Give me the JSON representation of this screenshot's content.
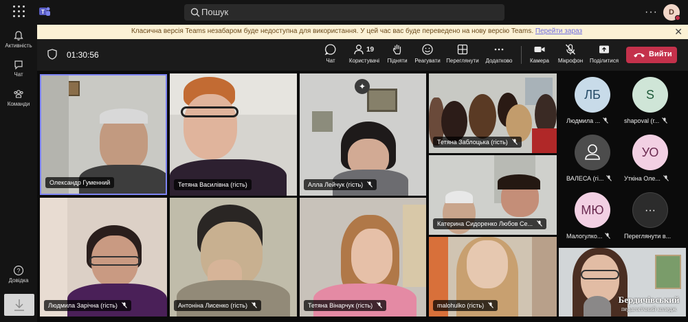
{
  "topbar": {
    "search_placeholder": "Пошук",
    "more_label": "···",
    "user_initial": "D"
  },
  "rail": {
    "items": [
      {
        "label": "Активність",
        "icon": "bell-icon"
      },
      {
        "label": "Чат",
        "icon": "chat-icon"
      },
      {
        "label": "Команди",
        "icon": "teams-icon"
      },
      {
        "label": "Довідка",
        "icon": "help-icon"
      }
    ]
  },
  "banner": {
    "message": "Класична версія Teams незабаром буде недоступна для використання. У цей час вас буде переведено на нову версію Teams.",
    "link": "Перейти зараз"
  },
  "meeting": {
    "timer": "01:30:56",
    "participants_count": "19",
    "tools": {
      "chat": "Чат",
      "people": "Користувачі",
      "raise": "Підняти",
      "react": "Реагувати",
      "view": "Переглянути",
      "more": "Додатково",
      "camera": "Камера",
      "mic": "Мікрофон",
      "share": "Поділитися"
    },
    "leave_label": "Вийти"
  },
  "tiles": [
    {
      "name": "Олександр Гуменний",
      "muted": false
    },
    {
      "name": "Тетяна Василівна (гість)",
      "muted": false
    },
    {
      "name": "Алла Лейчук (гість)",
      "muted": true
    },
    {
      "name": "Тетяна Заблоцька (гість)",
      "muted": true
    },
    {
      "name": "Катерина Сидоренко Любов Се...",
      "muted": true
    },
    {
      "name": "Людмила Зарічна (гість)",
      "muted": true
    },
    {
      "name": "Антоніна Лисенко (гість)",
      "muted": true
    },
    {
      "name": "Тетяна Вінарчук (гість)",
      "muted": true
    },
    {
      "name": "malohulko (гість)",
      "muted": true
    }
  ],
  "roster": [
    {
      "initials": "ЛБ",
      "name": "Людмила ...",
      "color": "#c8dbe9",
      "text_color": "#244a66"
    },
    {
      "initials": "S",
      "name": "shapoval (г...",
      "color": "#cfe5d7",
      "text_color": "#1f5a3a"
    },
    {
      "initials": "",
      "name": "ВАЛЕСА (гі...",
      "color": "#4c4c4c",
      "text_color": "#ffffff"
    },
    {
      "initials": "УО",
      "name": "Уткіна Оле...",
      "color": "#f2d0e3",
      "text_color": "#6a2a50"
    },
    {
      "initials": "МЮ",
      "name": "Малогулко...",
      "color": "#f2d0e3",
      "text_color": "#6a2a50"
    },
    {
      "initials": "···",
      "name": "Переглянути в...",
      "color": "#2c2c2c",
      "text_color": "#ffffff"
    }
  ],
  "self_view": {
    "watermark_line1": "Бердичівський",
    "watermark_line2": "педагогічний коледж"
  }
}
